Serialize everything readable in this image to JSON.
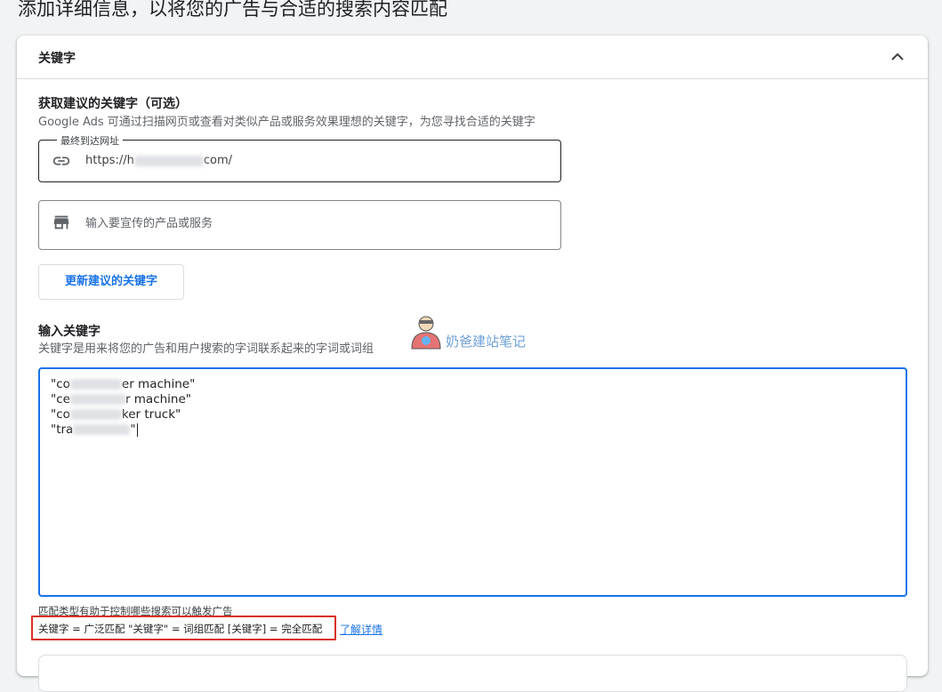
{
  "page": {
    "heading": "添加详细信息，以将您的广告与合适的搜索内容匹配"
  },
  "section": {
    "title": "关键字",
    "collapse_icon": "chevron-up-icon"
  },
  "suggest": {
    "title": "获取建议的关键字（可选）",
    "description": "Google Ads 可通过扫描网页或查看对类似产品或服务效果理想的关键字，为您寻找合适的关键字",
    "url_field": {
      "label": "最终到达网址",
      "icon": "link-icon",
      "value_prefix": "https://h",
      "value_suffix": "com/"
    },
    "product_field": {
      "icon": "storefront-icon",
      "placeholder": "输入要宣传的产品或服务"
    },
    "update_button": "更新建议的关键字"
  },
  "keywords": {
    "title": "输入关键字",
    "description": "关键字是用来将您的广告和用户搜索的字词联系起来的字词或词组",
    "lines": [
      {
        "prefix": "\"co",
        "suffix": "er machine\""
      },
      {
        "prefix": "\"ce",
        "suffix": "r machine\""
      },
      {
        "prefix": "\"co",
        "suffix": "ker truck\""
      },
      {
        "prefix": "\"tra",
        "suffix": "\""
      }
    ],
    "hint": "匹配类型有助于控制哪些搜索可以触发广告",
    "match_types": "关键字 = 广泛匹配  \"关键字\" = 词组匹配  [关键字] = 完全匹配",
    "learn_more": "了解详情"
  },
  "watermark": {
    "text": "奶爸建站笔记",
    "icon": "mascot-icon"
  },
  "colors": {
    "accent": "#1a73e8",
    "highlight_border": "#d93025",
    "watermark": "#6ea0d8"
  }
}
